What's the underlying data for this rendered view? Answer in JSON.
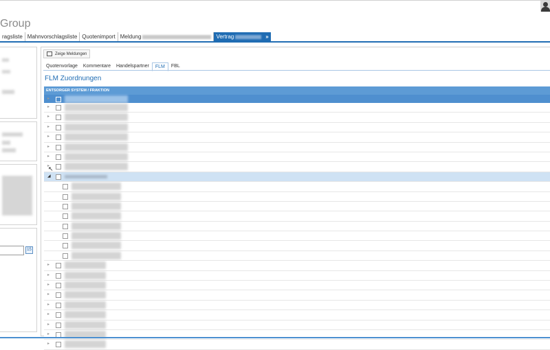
{
  "app": {
    "title": "Group"
  },
  "tabs": [
    {
      "label": "ragsliste",
      "active": false
    },
    {
      "label": "Mahnvorschlagsliste",
      "active": false
    },
    {
      "label": "Quotenimport",
      "active": false
    },
    {
      "label": "Meldung",
      "active": false
    },
    {
      "label": "Vertrag",
      "active": true,
      "close": "»"
    }
  ],
  "main": {
    "show_messages_label": "Zeige Meldungen",
    "subtabs": [
      {
        "label": "Quotenvorlage",
        "active": false
      },
      {
        "label": "Kommentare",
        "active": false
      },
      {
        "label": "Handelspartner",
        "active": false
      },
      {
        "label": "FLM",
        "active": true
      },
      {
        "label": "FBL",
        "active": false
      }
    ],
    "section_title": "FLM Zuordnungen",
    "grid_header": "ENTSORGER SYSTEM / FRAKTION"
  },
  "colors": {
    "accent": "#1f6cb3",
    "grid_header": "#5d9bd5",
    "selected_row": "#cfe2f4"
  }
}
